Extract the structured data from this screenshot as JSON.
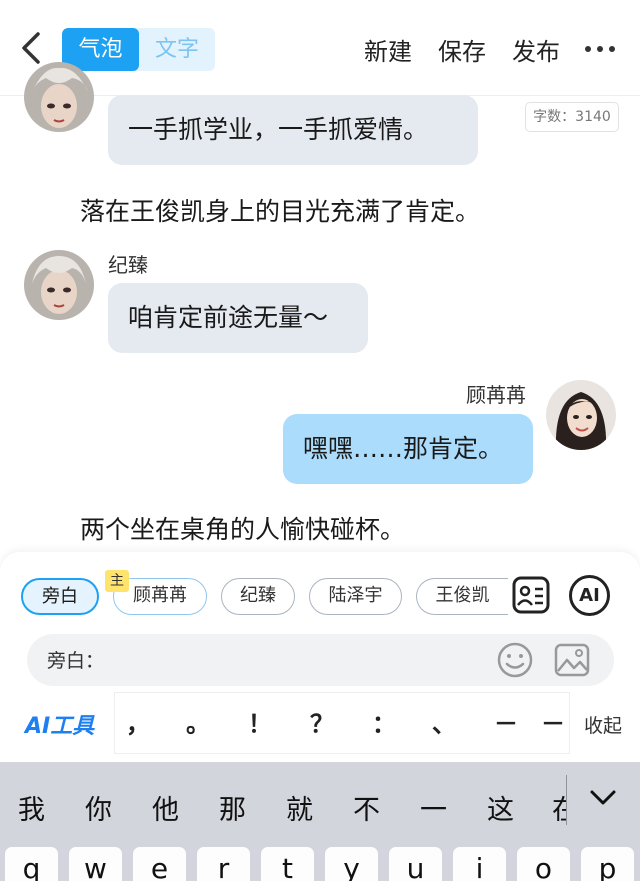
{
  "header": {
    "seg_bubble": "气泡",
    "seg_text": "文字",
    "new": "新建",
    "save": "保存",
    "publish": "发布"
  },
  "word_count": "字数：3140",
  "chat": {
    "msg1": "一手抓学业，一手抓爱情。",
    "narr1": "落在王俊凯身上的目光充满了肯定。",
    "name2": "纪臻",
    "msg2": "咱肯定前途无量～",
    "name3": "顾苒苒",
    "msg3": "嘿嘿……那肯定。",
    "narr2": "两个坐在桌角的人愉快碰杯。"
  },
  "roles": {
    "main_tag": "主",
    "items": [
      "旁白",
      "顾苒苒",
      "纪臻",
      "陆泽宇",
      "王俊凯"
    ]
  },
  "input": {
    "label": "旁白："
  },
  "toolbar": {
    "ai_tools": "AI工具",
    "ai_button": "AI",
    "punctuation": [
      "，",
      "。",
      "！",
      "？",
      "：",
      "、",
      "－",
      "－"
    ],
    "collapse": "收起"
  },
  "keyboard": {
    "candidates": [
      "我",
      "你",
      "他",
      "那",
      "就",
      "不",
      "一",
      "这",
      "在"
    ],
    "keys": [
      "q",
      "w",
      "e",
      "r",
      "t",
      "y",
      "u",
      "i",
      "o",
      "p"
    ]
  },
  "colors": {
    "accent": "#1da1f2",
    "bubble_gray": "#e5e9f0",
    "bubble_blue": "#abdcfc",
    "ai_blue": "#1e7ff0",
    "keyboard_bg": "#d2d5db"
  }
}
